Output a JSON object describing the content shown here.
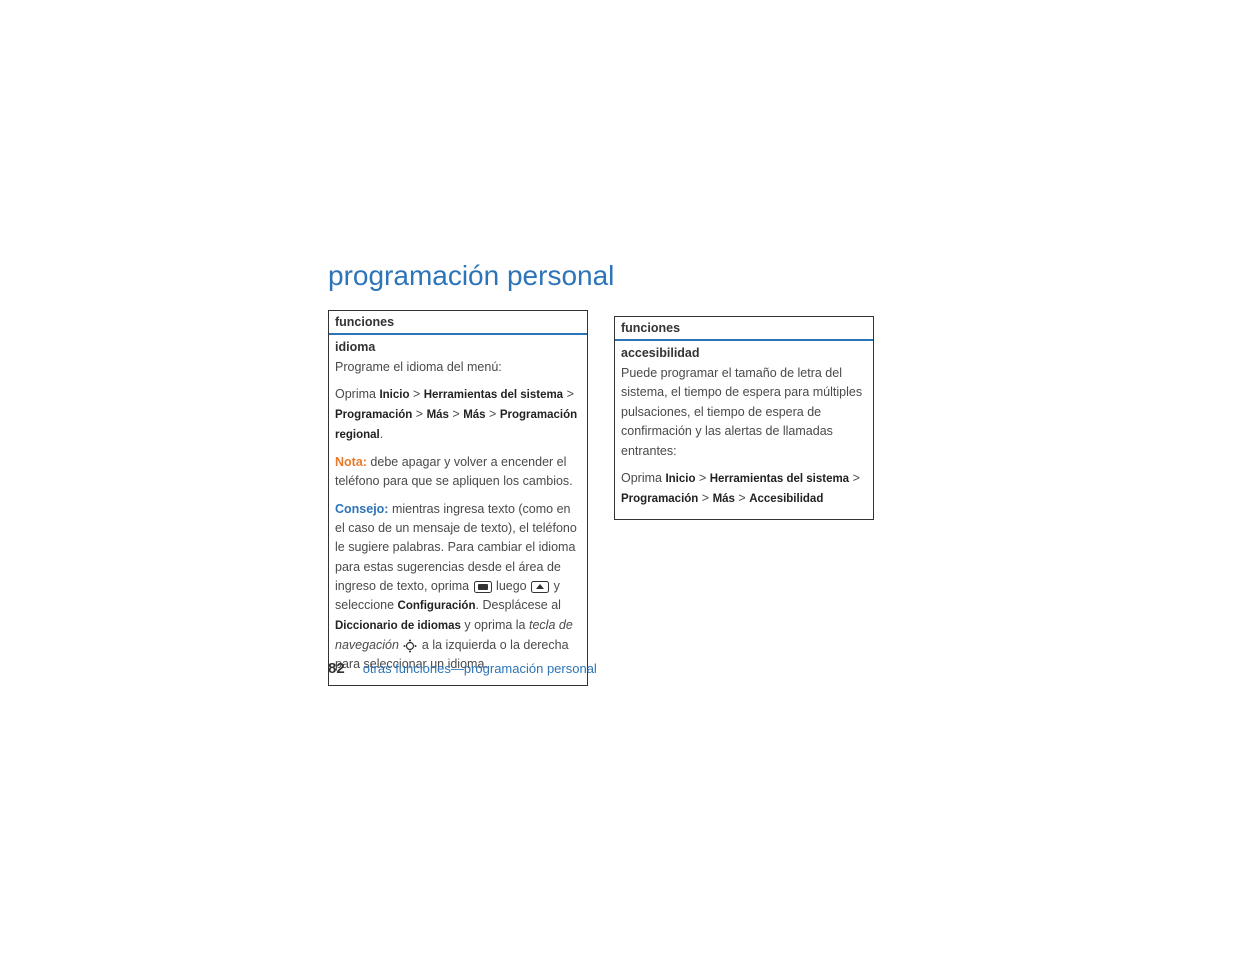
{
  "section_title": "programación personal",
  "left": {
    "header": "funciones",
    "subheader": "idioma",
    "intro": "Programe el idioma del menú:",
    "path_prefix": "Oprima ",
    "path_parts": [
      "Inicio",
      "Herramientas del sistema",
      "Programación",
      "Más",
      "Más",
      "Programación regional"
    ],
    "gt": " > ",
    "nota_label": "Nota: ",
    "nota_text": "debe apagar y volver a encender el teléfono para que se apliquen los cambios.",
    "consejo_label": "Consejo: ",
    "consejo_part1": "mientras ingresa texto (como en el caso de un mensaje de texto), el teléfono le sugiere palabras. Para cambiar el idioma para estas sugerencias desde el área de ingreso de texto, oprima ",
    "consejo_mid": " luego ",
    "consejo_select": " y seleccione ",
    "configuracion": "Configuración",
    "consejo_part2": ". Desplácese al ",
    "diccionario": "Diccionario de idiomas",
    "consejo_part3": " y oprima la ",
    "tecla_nav": "tecla de navegación",
    "consejo_part4": " a la izquierda o la derecha para seleccionar un idioma."
  },
  "right": {
    "header": "funciones",
    "subheader": "accesibilidad",
    "intro": "Puede programar el tamaño de letra del sistema, el tiempo de espera para múltiples pulsaciones, el tiempo de espera de confirmación y las alertas de llamadas entrantes:",
    "path_prefix": "Oprima ",
    "path_parts": [
      "Inicio",
      "Herramientas del sistema",
      "Programación",
      "Más",
      "Accesibilidad"
    ],
    "gt": " > "
  },
  "footer": {
    "page": "82",
    "crumb": "otras funciones—programación personal"
  }
}
